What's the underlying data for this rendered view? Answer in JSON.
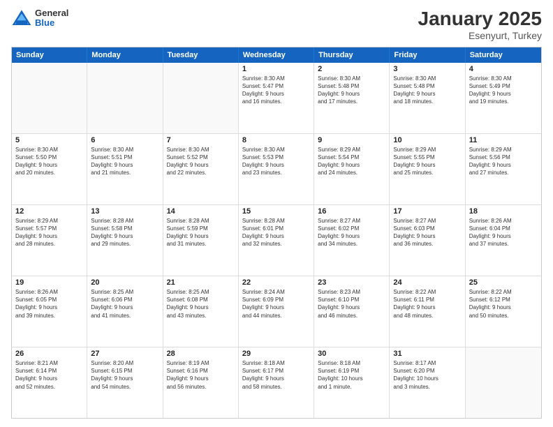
{
  "logo": {
    "line1": "General",
    "line2": "Blue"
  },
  "title": "January 2025",
  "subtitle": "Esenyurt, Turkey",
  "days": [
    "Sunday",
    "Monday",
    "Tuesday",
    "Wednesday",
    "Thursday",
    "Friday",
    "Saturday"
  ],
  "rows": [
    [
      {
        "day": "",
        "empty": true
      },
      {
        "day": "",
        "empty": true
      },
      {
        "day": "",
        "empty": true
      },
      {
        "day": "1",
        "lines": [
          "Sunrise: 8:30 AM",
          "Sunset: 5:47 PM",
          "Daylight: 9 hours",
          "and 16 minutes."
        ]
      },
      {
        "day": "2",
        "lines": [
          "Sunrise: 8:30 AM",
          "Sunset: 5:48 PM",
          "Daylight: 9 hours",
          "and 17 minutes."
        ]
      },
      {
        "day": "3",
        "lines": [
          "Sunrise: 8:30 AM",
          "Sunset: 5:48 PM",
          "Daylight: 9 hours",
          "and 18 minutes."
        ]
      },
      {
        "day": "4",
        "lines": [
          "Sunrise: 8:30 AM",
          "Sunset: 5:49 PM",
          "Daylight: 9 hours",
          "and 19 minutes."
        ]
      }
    ],
    [
      {
        "day": "5",
        "lines": [
          "Sunrise: 8:30 AM",
          "Sunset: 5:50 PM",
          "Daylight: 9 hours",
          "and 20 minutes."
        ]
      },
      {
        "day": "6",
        "lines": [
          "Sunrise: 8:30 AM",
          "Sunset: 5:51 PM",
          "Daylight: 9 hours",
          "and 21 minutes."
        ]
      },
      {
        "day": "7",
        "lines": [
          "Sunrise: 8:30 AM",
          "Sunset: 5:52 PM",
          "Daylight: 9 hours",
          "and 22 minutes."
        ]
      },
      {
        "day": "8",
        "lines": [
          "Sunrise: 8:30 AM",
          "Sunset: 5:53 PM",
          "Daylight: 9 hours",
          "and 23 minutes."
        ]
      },
      {
        "day": "9",
        "lines": [
          "Sunrise: 8:29 AM",
          "Sunset: 5:54 PM",
          "Daylight: 9 hours",
          "and 24 minutes."
        ]
      },
      {
        "day": "10",
        "lines": [
          "Sunrise: 8:29 AM",
          "Sunset: 5:55 PM",
          "Daylight: 9 hours",
          "and 25 minutes."
        ]
      },
      {
        "day": "11",
        "lines": [
          "Sunrise: 8:29 AM",
          "Sunset: 5:56 PM",
          "Daylight: 9 hours",
          "and 27 minutes."
        ]
      }
    ],
    [
      {
        "day": "12",
        "lines": [
          "Sunrise: 8:29 AM",
          "Sunset: 5:57 PM",
          "Daylight: 9 hours",
          "and 28 minutes."
        ]
      },
      {
        "day": "13",
        "lines": [
          "Sunrise: 8:28 AM",
          "Sunset: 5:58 PM",
          "Daylight: 9 hours",
          "and 29 minutes."
        ]
      },
      {
        "day": "14",
        "lines": [
          "Sunrise: 8:28 AM",
          "Sunset: 5:59 PM",
          "Daylight: 9 hours",
          "and 31 minutes."
        ]
      },
      {
        "day": "15",
        "lines": [
          "Sunrise: 8:28 AM",
          "Sunset: 6:01 PM",
          "Daylight: 9 hours",
          "and 32 minutes."
        ]
      },
      {
        "day": "16",
        "lines": [
          "Sunrise: 8:27 AM",
          "Sunset: 6:02 PM",
          "Daylight: 9 hours",
          "and 34 minutes."
        ]
      },
      {
        "day": "17",
        "lines": [
          "Sunrise: 8:27 AM",
          "Sunset: 6:03 PM",
          "Daylight: 9 hours",
          "and 36 minutes."
        ]
      },
      {
        "day": "18",
        "lines": [
          "Sunrise: 8:26 AM",
          "Sunset: 6:04 PM",
          "Daylight: 9 hours",
          "and 37 minutes."
        ]
      }
    ],
    [
      {
        "day": "19",
        "lines": [
          "Sunrise: 8:26 AM",
          "Sunset: 6:05 PM",
          "Daylight: 9 hours",
          "and 39 minutes."
        ]
      },
      {
        "day": "20",
        "lines": [
          "Sunrise: 8:25 AM",
          "Sunset: 6:06 PM",
          "Daylight: 9 hours",
          "and 41 minutes."
        ]
      },
      {
        "day": "21",
        "lines": [
          "Sunrise: 8:25 AM",
          "Sunset: 6:08 PM",
          "Daylight: 9 hours",
          "and 43 minutes."
        ]
      },
      {
        "day": "22",
        "lines": [
          "Sunrise: 8:24 AM",
          "Sunset: 6:09 PM",
          "Daylight: 9 hours",
          "and 44 minutes."
        ]
      },
      {
        "day": "23",
        "lines": [
          "Sunrise: 8:23 AM",
          "Sunset: 6:10 PM",
          "Daylight: 9 hours",
          "and 46 minutes."
        ]
      },
      {
        "day": "24",
        "lines": [
          "Sunrise: 8:22 AM",
          "Sunset: 6:11 PM",
          "Daylight: 9 hours",
          "and 48 minutes."
        ]
      },
      {
        "day": "25",
        "lines": [
          "Sunrise: 8:22 AM",
          "Sunset: 6:12 PM",
          "Daylight: 9 hours",
          "and 50 minutes."
        ]
      }
    ],
    [
      {
        "day": "26",
        "lines": [
          "Sunrise: 8:21 AM",
          "Sunset: 6:14 PM",
          "Daylight: 9 hours",
          "and 52 minutes."
        ]
      },
      {
        "day": "27",
        "lines": [
          "Sunrise: 8:20 AM",
          "Sunset: 6:15 PM",
          "Daylight: 9 hours",
          "and 54 minutes."
        ]
      },
      {
        "day": "28",
        "lines": [
          "Sunrise: 8:19 AM",
          "Sunset: 6:16 PM",
          "Daylight: 9 hours",
          "and 56 minutes."
        ]
      },
      {
        "day": "29",
        "lines": [
          "Sunrise: 8:18 AM",
          "Sunset: 6:17 PM",
          "Daylight: 9 hours",
          "and 58 minutes."
        ]
      },
      {
        "day": "30",
        "lines": [
          "Sunrise: 8:18 AM",
          "Sunset: 6:19 PM",
          "Daylight: 10 hours",
          "and 1 minute."
        ]
      },
      {
        "day": "31",
        "lines": [
          "Sunrise: 8:17 AM",
          "Sunset: 6:20 PM",
          "Daylight: 10 hours",
          "and 3 minutes."
        ]
      },
      {
        "day": "",
        "empty": true
      }
    ]
  ]
}
